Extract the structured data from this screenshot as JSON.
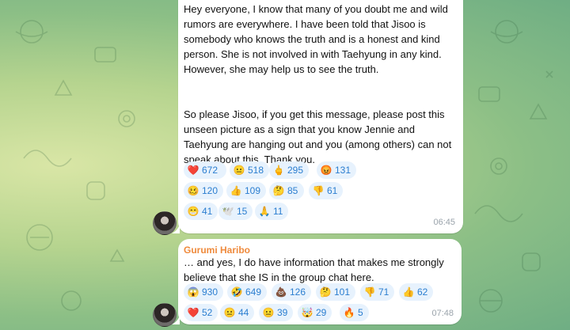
{
  "messages": [
    {
      "text_p1": "Hey everyone, I know that many of you doubt me and wild rumors are everywhere. I have been told that Jisoo is somebody who knows the truth and is a honest and kind person. She is not involved in with Taehyung in any kind. However, she may help us to see the truth.",
      "text_p2": "So please Jisoo, if you get this message, please post this unseen picture as a sign that you know Jennie and Taehyung are hanging out and you (among others) can not speak about this. Thank you.",
      "time": "06:45",
      "reactions": [
        {
          "emoji": "❤️",
          "icon": "heart-icon",
          "count": "672"
        },
        {
          "emoji": "😐",
          "icon": "neutral-face-icon",
          "count": "518"
        },
        {
          "emoji": "🖕",
          "icon": "middle-finger-icon",
          "count": "295"
        },
        {
          "emoji": "😡",
          "icon": "angry-face-icon",
          "count": "131"
        },
        {
          "emoji": "🥴",
          "icon": "woozy-face-icon",
          "count": "120"
        },
        {
          "emoji": "👍",
          "icon": "thumbs-up-icon",
          "count": "109"
        },
        {
          "emoji": "🤔",
          "icon": "thinking-face-icon",
          "count": "85"
        },
        {
          "emoji": "👎",
          "icon": "thumbs-down-icon",
          "count": "61"
        },
        {
          "emoji": "😁",
          "icon": "grin-face-icon",
          "count": "41"
        },
        {
          "emoji": "🕊️",
          "icon": "dove-icon",
          "count": "15"
        },
        {
          "emoji": "🙏",
          "icon": "praying-hands-icon",
          "count": "11"
        }
      ]
    },
    {
      "sender": "Gurumi Haribo",
      "text_p1": "… and yes, I do have information that makes me strongly believe that she IS in the group chat here.",
      "time": "07:48",
      "reactions": [
        {
          "emoji": "😱",
          "icon": "screaming-face-icon",
          "count": "930"
        },
        {
          "emoji": "🤣",
          "icon": "rofl-face-icon",
          "count": "649"
        },
        {
          "emoji": "💩",
          "icon": "poop-icon",
          "count": "126"
        },
        {
          "emoji": "🤔",
          "icon": "thinking-face-icon",
          "count": "101"
        },
        {
          "emoji": "👎",
          "icon": "thumbs-down-icon",
          "count": "71"
        },
        {
          "emoji": "👍",
          "icon": "thumbs-up-icon",
          "count": "62"
        },
        {
          "emoji": "❤️",
          "icon": "heart-icon",
          "count": "52"
        },
        {
          "emoji": "😐",
          "icon": "neutral-face-icon",
          "count": "44"
        },
        {
          "emoji": "😐",
          "icon": "neutral-face-icon",
          "count": "39"
        },
        {
          "emoji": "🤯",
          "icon": "exploding-head-icon",
          "count": "29"
        },
        {
          "emoji": "🔥",
          "icon": "fire-icon",
          "count": "5"
        }
      ]
    }
  ]
}
